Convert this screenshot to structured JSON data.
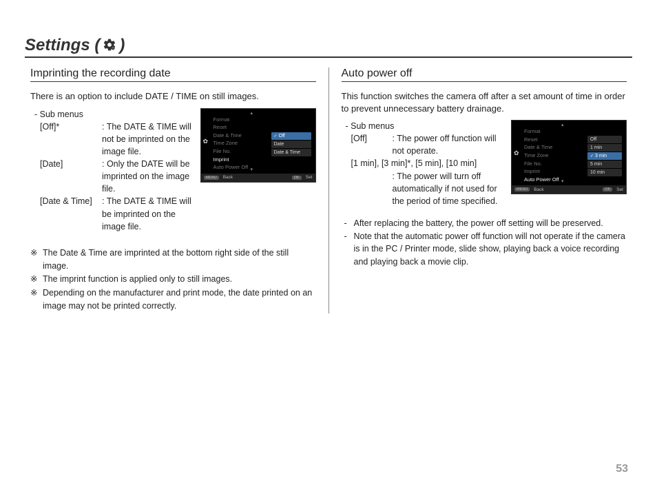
{
  "page_number": "53",
  "title_prefix": "Settings (",
  "title_suffix": ")",
  "gear_icon_name": "settings-gear-icon",
  "left": {
    "heading": "Imprinting the recording date",
    "intro": "There is an option to include DATE / TIME on still images.",
    "sub_label": "- Sub menus",
    "items": [
      {
        "key": "[Off]*",
        "val": ": The DATE & TIME will not be imprinted on the image file."
      },
      {
        "key": "[Date]",
        "val": ": Only the DATE will be imprinted on the image file."
      },
      {
        "key": "[Date & Time]",
        "val": ": The DATE & TIME will be imprinted on the image file."
      }
    ],
    "notes": [
      "The Date & Time are imprinted at the bottom right side of the still image.",
      "The imprint function is applied only to still images.",
      "Depending on the manufacturer and print mode, the date printed on an image may not be printed correctly."
    ],
    "note_symbol": "※",
    "lcd": {
      "menu": [
        "Format",
        "Reset",
        "Date & Time",
        "Time Zone",
        "File No.",
        "Imprint",
        "Auto Power Off"
      ],
      "selected_index": 5,
      "right_label_off": "Off",
      "options": [
        "Off",
        "Date",
        "Date & Time"
      ],
      "option_selected": 0,
      "back": "Back",
      "set": "Set",
      "menu_btn": "MENU",
      "ok_btn": "OK"
    }
  },
  "right": {
    "heading": "Auto power off",
    "intro": "This function switches the camera off after a set amount of time in order to prevent unnecessary battery drainage.",
    "sub_label": "- Sub menus",
    "row1_key": "[Off]",
    "row1_val": ": The power off function will not operate.",
    "row2_key": "[1 min], [3 min]*, [5 min], [10 min]",
    "row2_val": ": The power will turn off automatically if not used for the period of time specified.",
    "dash_notes": [
      "After replacing the battery, the power off setting will be preserved.",
      "Note that the automatic power off function will not operate if the camera is in the PC / Printer mode, slide show, playing back a voice recording and playing back a movie clip."
    ],
    "lcd": {
      "menu": [
        "Format",
        "Reset",
        "Date & Time",
        "Time Zone",
        "File No.",
        "Imprint",
        "Auto Power Off"
      ],
      "selected_index": 6,
      "options": [
        "Off",
        "1 min",
        "3 min",
        "5 min",
        "10 min"
      ],
      "option_selected": 2,
      "back": "Back",
      "set": "Set",
      "menu_btn": "MENU",
      "ok_btn": "OK"
    }
  }
}
